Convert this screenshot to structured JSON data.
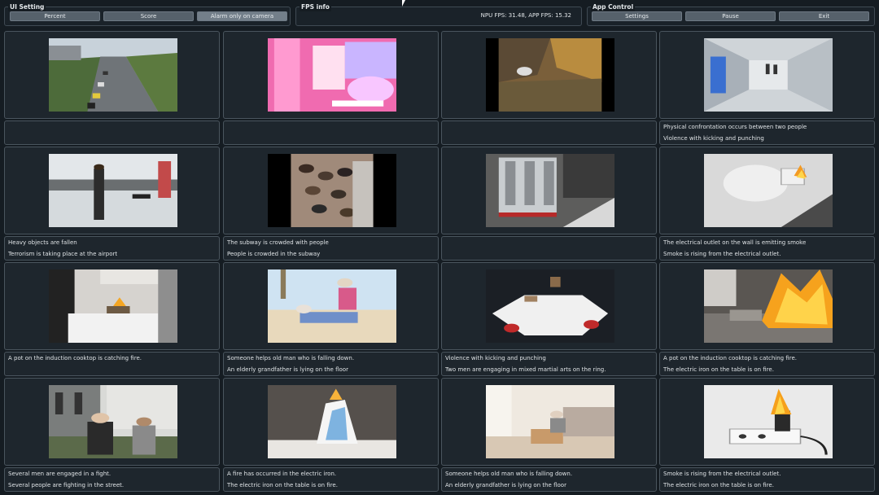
{
  "ui_setting": {
    "title": "UI Setting",
    "buttons": [
      "Percent",
      "Score",
      "Alarm only on camera"
    ]
  },
  "fps_info": {
    "title": "FPS info",
    "text": "NPU FPS: 31.48, APP FPS: 15.32"
  },
  "app_control": {
    "title": "App Control",
    "buttons": [
      "Settings",
      "Pause",
      "Exit"
    ]
  },
  "cells": [
    {
      "scene": "highway",
      "captions": [
        "",
        ""
      ]
    },
    {
      "scene": "pink",
      "captions": [
        "",
        ""
      ]
    },
    {
      "scene": "rubble",
      "captions": [
        "",
        ""
      ]
    },
    {
      "scene": "corridor",
      "captions": [
        "Physical confrontation occurs between two people",
        "Violence with kicking and punching"
      ]
    },
    {
      "scene": "airport",
      "captions": [
        "Heavy objects are fallen",
        "Terrorism is taking place at the airport"
      ]
    },
    {
      "scene": "crowd",
      "captions": [
        "The subway is crowded with people",
        "People is crowded in the subway"
      ]
    },
    {
      "scene": "machine",
      "captions": [
        "",
        ""
      ]
    },
    {
      "scene": "outlet-smoke",
      "captions": [
        "The electrical outlet on the wall is emitting smoke",
        "Smoke is rising from the electrical outlet."
      ]
    },
    {
      "scene": "kitchen",
      "captions": [
        "A pot on the induction cooktop is catching fire.",
        ""
      ]
    },
    {
      "scene": "beach",
      "captions": [
        "Someone helps old man who is falling down.",
        "An elderly grandfather is lying on the floor"
      ]
    },
    {
      "scene": "ring",
      "captions": [
        "Violence with kicking and punching",
        "Two men are engaging in mixed martial arts on the ring."
      ]
    },
    {
      "scene": "stove-fire",
      "captions": [
        "A pot on the induction cooktop is catching fire.",
        "The electric iron on the table is on fire."
      ]
    },
    {
      "scene": "street-fight",
      "captions": [
        "Several men are engaged in a fight.",
        "Several people are fighting in the street."
      ]
    },
    {
      "scene": "iron",
      "captions": [
        "A fire has occurred in the electric iron.",
        "The electric iron on the table is on fire."
      ]
    },
    {
      "scene": "living-room",
      "captions": [
        "Someone helps old man who is falling down.",
        "An elderly grandfather is lying on the floor"
      ]
    },
    {
      "scene": "plug-fire",
      "captions": [
        "Smoke is rising from the electrical outlet.",
        "The electric iron on the table is on fire."
      ]
    }
  ]
}
